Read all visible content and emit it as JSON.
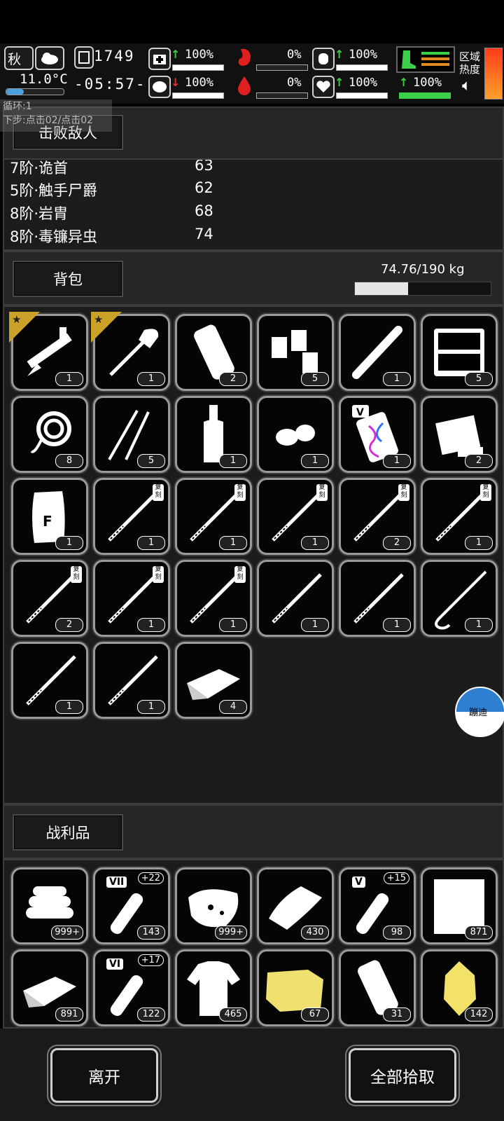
{
  "hud": {
    "season": "秋",
    "temperature": "11.0°C",
    "day": "1749",
    "time": "-05:57-",
    "stats": [
      {
        "value": "100%"
      },
      {
        "value": "0%"
      },
      {
        "value": "100%"
      },
      {
        "value": "100%"
      },
      {
        "value": "100%"
      },
      {
        "value": "0%"
      },
      {
        "value": "100%"
      }
    ],
    "region_heat_label": "区域\n热度"
  },
  "overlay": {
    "line1": "循环:1",
    "line2": "下步:点击02/点击02"
  },
  "kills": {
    "title": "击败敌人",
    "rows": [
      {
        "name": "7阶·诡首",
        "count": "63"
      },
      {
        "name": "5阶·触手尸爵",
        "count": "62"
      },
      {
        "name": "8阶·岩胄",
        "count": "68"
      },
      {
        "name": "8阶·毒镰异虫",
        "count": "74"
      }
    ]
  },
  "backpack": {
    "title": "背包",
    "weight": "74.76/190 kg",
    "weight_fraction": 0.393,
    "items": [
      {
        "icon": "caliper-icon",
        "count": "1",
        "starred": true
      },
      {
        "icon": "shovel-icon",
        "count": "1",
        "starred": true
      },
      {
        "icon": "bandage-roll-icon",
        "count": "2"
      },
      {
        "icon": "lantern-icon",
        "count": "5"
      },
      {
        "icon": "pipe-icon",
        "count": "1"
      },
      {
        "icon": "toolbox-icon",
        "count": "5"
      },
      {
        "icon": "rope-icon",
        "count": "8"
      },
      {
        "icon": "picks-icon",
        "count": "5"
      },
      {
        "icon": "bottle-icon",
        "count": "1"
      },
      {
        "icon": "seeds-icon",
        "count": "1"
      },
      {
        "icon": "dna-device-icon",
        "count": "1",
        "tier": "V"
      },
      {
        "icon": "repair-kit-icon",
        "count": "2"
      },
      {
        "icon": "flour-sack-icon",
        "count": "1",
        "label": "F"
      },
      {
        "icon": "spear-icon",
        "count": "1",
        "copy": "复刻"
      },
      {
        "icon": "spear-icon",
        "count": "1",
        "copy": "复刻"
      },
      {
        "icon": "spear-icon",
        "count": "1",
        "copy": "复刻"
      },
      {
        "icon": "spear-icon",
        "count": "2",
        "copy": "复刻"
      },
      {
        "icon": "spear-icon",
        "count": "1",
        "copy": "复刻"
      },
      {
        "icon": "spear-icon",
        "count": "2",
        "copy": "复刻"
      },
      {
        "icon": "spear-icon",
        "count": "1",
        "copy": "复刻"
      },
      {
        "icon": "spear-icon",
        "count": "1",
        "copy": "复刻"
      },
      {
        "icon": "spear-icon",
        "count": "1"
      },
      {
        "icon": "spear-icon",
        "count": "1"
      },
      {
        "icon": "hook-spear-icon",
        "count": "1"
      },
      {
        "icon": "spear-icon",
        "count": "1"
      },
      {
        "icon": "spear-icon",
        "count": "1"
      },
      {
        "icon": "cloth-icon",
        "count": "4"
      }
    ]
  },
  "float_button": "蹦迪",
  "loot": {
    "title": "战利品",
    "items": [
      {
        "icon": "fabric-stack-icon",
        "count": "999+"
      },
      {
        "icon": "test-tube-icon",
        "count": "143",
        "tier": "VII",
        "plus": "+22"
      },
      {
        "icon": "meat-icon",
        "count": "999+"
      },
      {
        "icon": "towel-icon",
        "count": "430"
      },
      {
        "icon": "test-tube-icon",
        "count": "98",
        "tier": "V",
        "plus": "+15"
      },
      {
        "icon": "paper-icon",
        "count": "871"
      },
      {
        "icon": "cloth-icon",
        "count": "891"
      },
      {
        "icon": "test-tube-icon",
        "count": "122",
        "tier": "VI",
        "plus": "+17"
      },
      {
        "icon": "shirt-icon",
        "count": "465"
      },
      {
        "icon": "yellow-fabric-icon",
        "count": "67"
      },
      {
        "icon": "bandage-roll-icon",
        "count": "31"
      },
      {
        "icon": "gold-crystal-icon",
        "count": "142"
      }
    ]
  },
  "buttons": {
    "leave": "离开",
    "pickup_all": "全部拾取"
  }
}
